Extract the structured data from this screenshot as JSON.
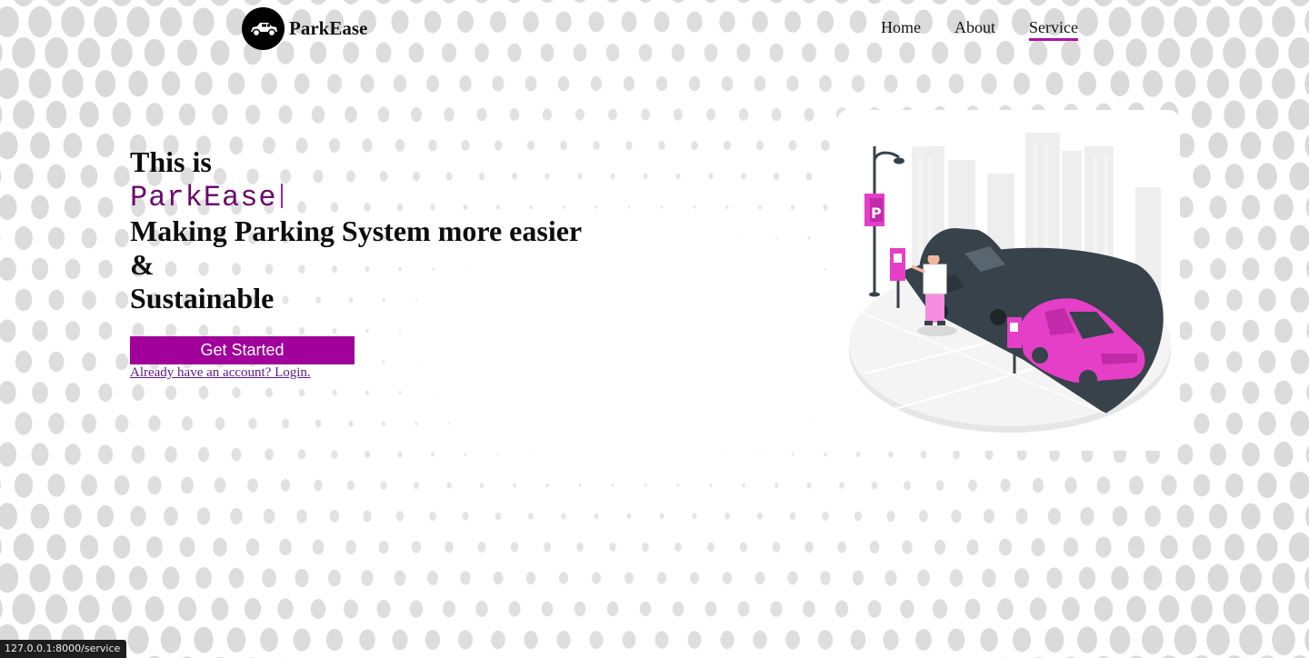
{
  "brand": {
    "name": "ParkEase",
    "logo_icon": "car-icon"
  },
  "nav": {
    "items": [
      {
        "label": "Home",
        "active": false
      },
      {
        "label": "About",
        "active": false
      },
      {
        "label": "Service",
        "active": true
      }
    ]
  },
  "hero": {
    "line1": "This is",
    "typed_text": "ParkEase",
    "line3": "Making Parking System more easier",
    "line4": "&",
    "line5": "Sustainable",
    "cta_label": "Get Started",
    "login_link": "Already have an account? Login."
  },
  "illustration": {
    "subject": "parking-lot-illustration",
    "sign_letter": "P"
  },
  "status_bar": {
    "url": "127.0.0.1:8000/service"
  },
  "colors": {
    "accent": "#a1009a",
    "typed_text": "#6a0a6c",
    "active_underline": "#b0129f",
    "illustration_pink": "#e53fc7",
    "illustration_dark": "#37424a"
  }
}
